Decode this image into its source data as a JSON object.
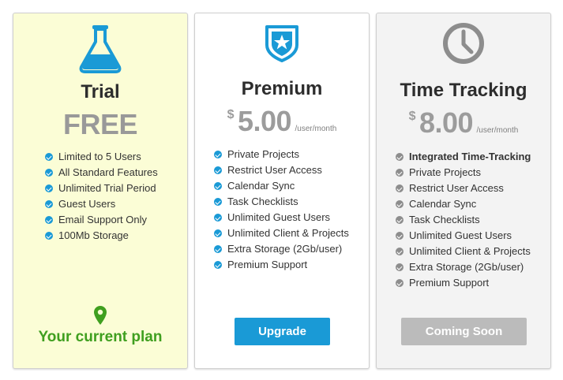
{
  "plans": {
    "trial": {
      "title": "Trial",
      "price_label": "FREE",
      "features": [
        "Limited to 5 Users",
        "All Standard Features",
        "Unlimited Trial Period",
        "Guest Users",
        "Email Support Only",
        "100Mb Storage"
      ],
      "current_plan_text": "Your current plan",
      "icon": "flask-icon"
    },
    "premium": {
      "title": "Premium",
      "currency": "$",
      "amount": "5.00",
      "period": "/user/month",
      "features": [
        "Private Projects",
        "Restrict User Access",
        "Calendar Sync",
        "Task Checklists",
        "Unlimited Guest Users",
        "Unlimited Client & Projects",
        "Extra Storage (2Gb/user)",
        "Premium Support"
      ],
      "button_label": "Upgrade",
      "icon": "badge-star-icon"
    },
    "time_tracking": {
      "title": "Time Tracking",
      "currency": "$",
      "amount": "8.00",
      "period": "/user/month",
      "features": [
        "Integrated Time-Tracking",
        "Private Projects",
        "Restrict User Access",
        "Calendar Sync",
        "Task Checklists",
        "Unlimited Guest Users",
        "Unlimited Client & Projects",
        "Extra Storage (2Gb/user)",
        "Premium Support"
      ],
      "button_label": "Coming Soon",
      "icon": "clock-icon"
    }
  },
  "colors": {
    "accent_blue": "#1a9ad6",
    "success_green": "#3f9f1f",
    "trial_bg": "#fbfdd6",
    "disabled_grey": "#bbbbbb"
  }
}
